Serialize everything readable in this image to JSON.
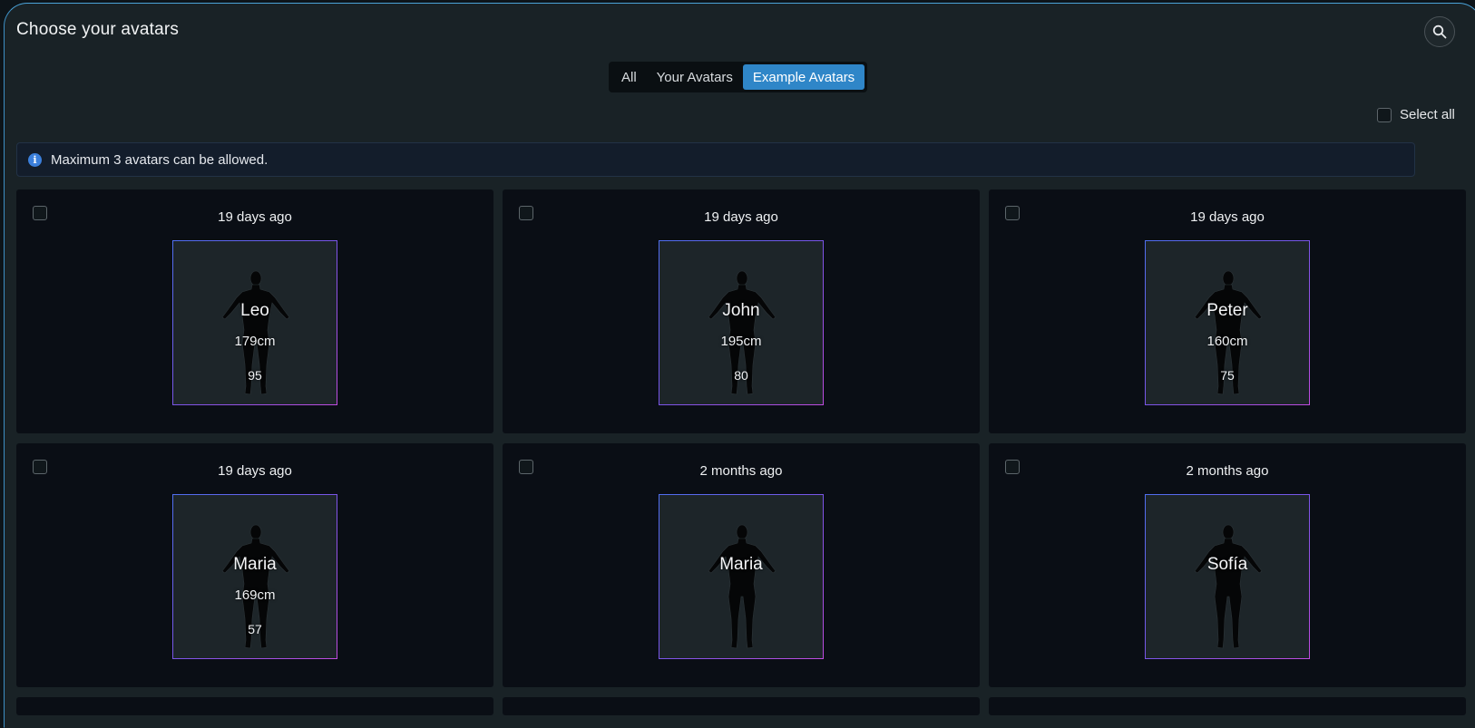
{
  "header": {
    "title": "Choose your avatars",
    "search_icon": "search-icon"
  },
  "tabs": [
    {
      "label": "All",
      "active": false
    },
    {
      "label": "Your Avatars",
      "active": false
    },
    {
      "label": "Example Avatars",
      "active": true
    }
  ],
  "select_all": {
    "label": "Select all",
    "checked": false
  },
  "alert": {
    "icon": "info-icon",
    "text": "Maximum 3 avatars can be allowed."
  },
  "colors": {
    "accent": "#2f86c8",
    "info": "#3b7fdb",
    "border_start": "#4f6ff0",
    "border_end": "#c04ce0"
  },
  "avatars": [
    {
      "time": "19 days ago",
      "name": "Leo",
      "height": "179cm",
      "weight": "95",
      "checked": false
    },
    {
      "time": "19 days ago",
      "name": "John",
      "height": "195cm",
      "weight": "80",
      "checked": false
    },
    {
      "time": "19 days ago",
      "name": "Peter",
      "height": "160cm",
      "weight": "75",
      "checked": false
    },
    {
      "time": "19 days ago",
      "name": "Maria",
      "height": "169cm",
      "weight": "57",
      "checked": false
    },
    {
      "time": "2 months ago",
      "name": "Maria",
      "height": "",
      "weight": "",
      "checked": false
    },
    {
      "time": "2 months ago",
      "name": "Sofía",
      "height": "",
      "weight": "",
      "checked": false
    }
  ]
}
